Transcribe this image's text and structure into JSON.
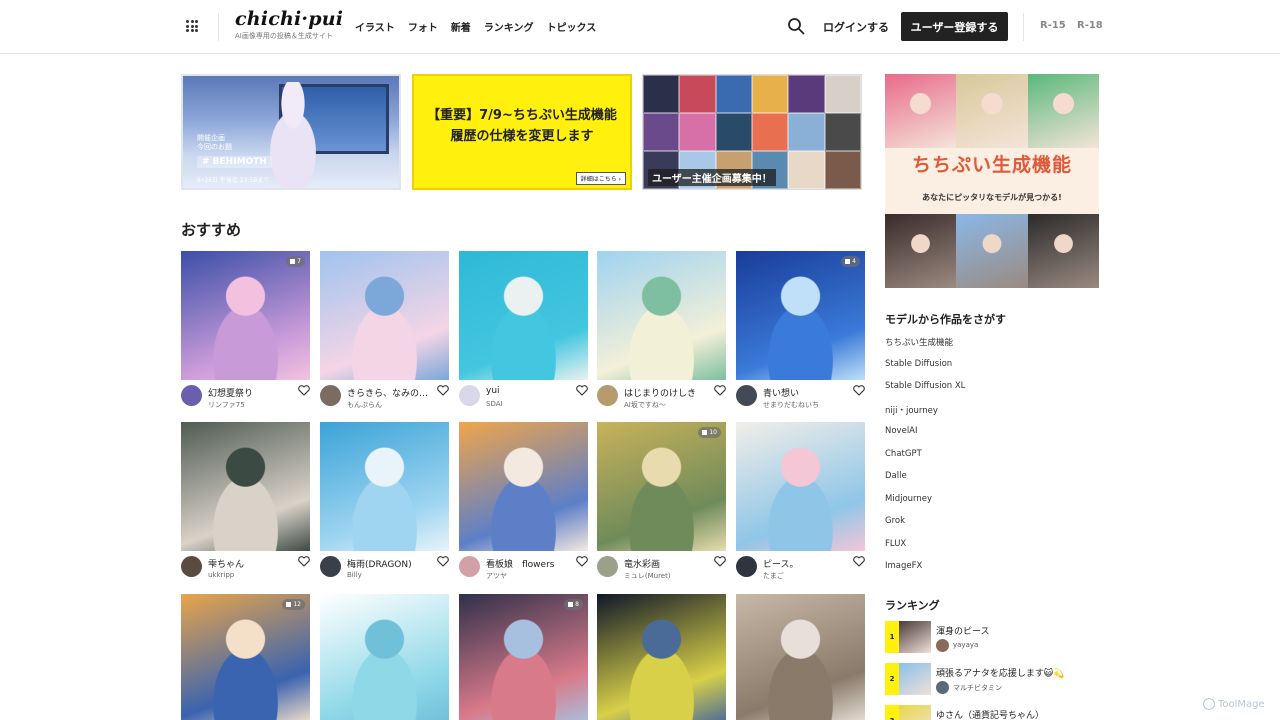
{
  "header": {
    "logo": "chichi·pui",
    "tagline": "AI画像専用の投稿＆生成サイト",
    "nav": [
      "イラスト",
      "フォト",
      "新着",
      "ランキング",
      "トピックス"
    ],
    "login": "ログインする",
    "signup": "ユーザー登録する",
    "r15": "R-15",
    "r18": "R-18"
  },
  "banners": {
    "b1_label_line1": "開催企画",
    "b1_label_line2": "今回のお題",
    "b1_tag": "# BEHIMOTH",
    "b1_date": "8•28日 午後迄 23:59まで",
    "b2_line1": "【重要】7/9~ちちぷい生成機能",
    "b2_line2": "履歴の仕様を変更します",
    "b2_button": "詳細はこちら ›",
    "b3_caption": "ユーザー主催企画募集中！"
  },
  "recommended": {
    "title": "おすすめ",
    "cards": [
      {
        "title": "幻想夏祭り",
        "user": "リンファ75",
        "badge": "7",
        "colors": [
          "#3b4fa8",
          "#c89ad8",
          "#f3c1e0"
        ],
        "avatar": "#6a5fae"
      },
      {
        "title": "きらきら、なみのお…",
        "user": "もんぷらん",
        "badge": "",
        "colors": [
          "#9fc3ef",
          "#f4d5e6",
          "#7ba7d9"
        ],
        "avatar": "#7a6b63"
      },
      {
        "title": "yui",
        "user": "SDAI",
        "badge": "",
        "colors": [
          "#2fb9d6",
          "#43c6e0",
          "#e9f2f0"
        ],
        "avatar": "#d8d8e8"
      },
      {
        "title": "はじまりのけしき",
        "user": "AI坂ですね〜",
        "badge": "",
        "colors": [
          "#9fd3f0",
          "#f3f0d8",
          "#7dbfa0"
        ],
        "avatar": "#b79a6d"
      },
      {
        "title": "青い想い",
        "user": "せまりだむねいち",
        "badge": "4",
        "colors": [
          "#1a3c9a",
          "#3a7ad8",
          "#bfe0f8"
        ],
        "avatar": "#444a55"
      },
      {
        "title": "雫ちゃん",
        "user": "ukkripp",
        "badge": "",
        "colors": [
          "#4f5b54",
          "#d9d2c8",
          "#3c4a44"
        ],
        "avatar": "#5a4a40"
      },
      {
        "title": "梅雨(DRAGON)",
        "user": "Billy",
        "badge": "",
        "colors": [
          "#3aa3d8",
          "#9fd5f0",
          "#e8f3fa"
        ],
        "avatar": "#3a3f4c"
      },
      {
        "title": "看板娘　flowers",
        "user": "アツヤ",
        "badge": "",
        "colors": [
          "#f0a54a",
          "#5d7fc8",
          "#f4e9e0"
        ],
        "avatar": "#d4a0a8"
      },
      {
        "title": "竜水彩画",
        "user": "ミュレ(Muret)",
        "badge": "10",
        "colors": [
          "#c9b25a",
          "#6f8b5a",
          "#e8dcae"
        ],
        "avatar": "#9aa08a"
      },
      {
        "title": "ピース。",
        "user": "たまご",
        "badge": "",
        "colors": [
          "#f2eee8",
          "#8fc6e8",
          "#f4c6d6"
        ],
        "avatar": "#2e3540"
      },
      {
        "title": "",
        "user": "",
        "badge": "12",
        "colors": [
          "#e8a54a",
          "#3a63b0",
          "#f4e0c8"
        ],
        "avatar": ""
      },
      {
        "title": "",
        "user": "",
        "badge": "",
        "colors": [
          "#ffffff",
          "#8fd8e8",
          "#6fc0d8"
        ],
        "avatar": ""
      },
      {
        "title": "",
        "user": "",
        "badge": "8",
        "colors": [
          "#30304a",
          "#d87a8a",
          "#a8c0e0"
        ],
        "avatar": ""
      },
      {
        "title": "",
        "user": "",
        "badge": "",
        "colors": [
          "#101828",
          "#d8d048",
          "#4a6a98"
        ],
        "avatar": ""
      },
      {
        "title": "",
        "user": "",
        "badge": "",
        "colors": [
          "#c8b8a8",
          "#8a7a6a",
          "#e8e0d8"
        ],
        "avatar": ""
      }
    ]
  },
  "side_banner": {
    "title": "ちちぷい生成機能",
    "subtitle": "あなたにピッタリなモデルが見つかる!",
    "top_colors": [
      "#e86a8a",
      "#d8c89a",
      "#5ab87a"
    ],
    "bottom_colors": [
      "#3a2a2a",
      "#8ab8e8",
      "#2a2a2a"
    ]
  },
  "models": {
    "title": "モデルから作品をさがす",
    "items": [
      "ちちぷい生成機能",
      "Stable Diffusion",
      "Stable Diffusion XL",
      "niji・journey",
      "NovelAI",
      "ChatGPT",
      "Dalle",
      "Midjourney",
      "Grok",
      "FLUX",
      "ImageFX"
    ]
  },
  "ranking": {
    "title": "ランキング",
    "items": [
      {
        "num": "1",
        "title": "渾身のピース",
        "user": "yayaya",
        "thumb": "#4a3a3a",
        "avatar": "#8a6a5a"
      },
      {
        "num": "2",
        "title": "頑張るアナタを応援します😺💫",
        "user": "マルチビタミン",
        "thumb": "#8ac0e8",
        "avatar": "#5a6a7a"
      },
      {
        "num": "3",
        "title": "ゆさん（通貨記号ちゃん）",
        "user": "",
        "thumb": "#e8d848",
        "avatar": ""
      }
    ]
  },
  "watermark": "ToolMage"
}
